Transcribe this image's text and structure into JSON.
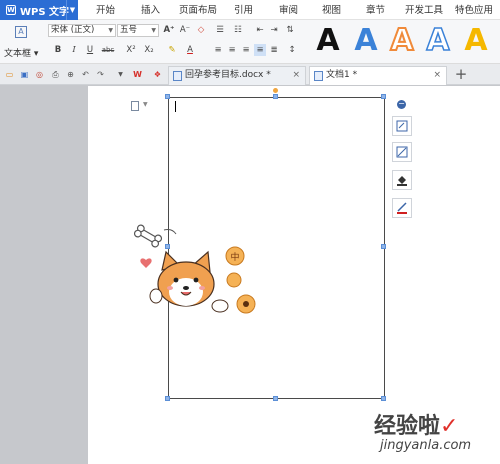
{
  "app": {
    "name": "WPS 文字"
  },
  "menu": [
    {
      "label": "开始"
    },
    {
      "label": "插入"
    },
    {
      "label": "页面布局"
    },
    {
      "label": "引用"
    },
    {
      "label": "审阅"
    },
    {
      "label": "视图"
    },
    {
      "label": "章节"
    },
    {
      "label": "开发工具"
    },
    {
      "label": "特色应用"
    }
  ],
  "ribbon": {
    "textbox_label": "文本框",
    "font_name": "宋体 (正文)",
    "font_size": "五号",
    "bold": "B",
    "italic": "I",
    "underline": "U",
    "strike": "abc",
    "superscript": "X²",
    "subscript": "X₂",
    "wordart_colors": [
      "#111111",
      "#3b82d8",
      "#f08a3a",
      "#3b82d8",
      "#f5b800"
    ],
    "wordart_letter": "A"
  },
  "tabs": [
    {
      "label": "回孕参考目标.docx *",
      "close": "×"
    },
    {
      "label": "文档1 *",
      "close": "×"
    }
  ],
  "new_tab": "+",
  "watermark": {
    "text": "经验啦",
    "check": "✓",
    "url": "jingyanla.com"
  },
  "illustration": {
    "coin_char": "中"
  }
}
